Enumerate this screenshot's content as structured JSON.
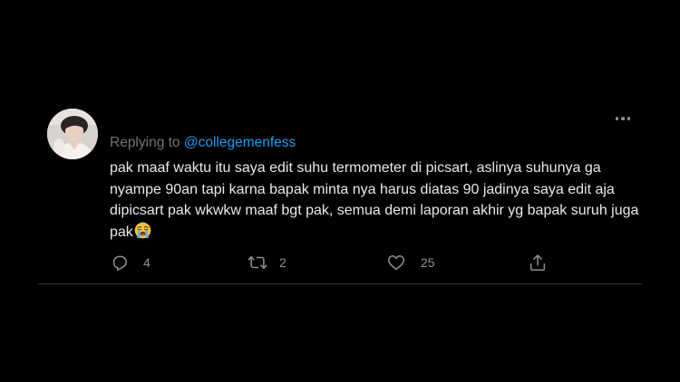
{
  "tweet": {
    "replying_prefix": "Replying to ",
    "replying_handle": "@collegemenfess",
    "body": "pak maaf waktu itu saya edit suhu termometer di picsart, aslinya suhunya ga nyampe 90an tapi karna bapak minta nya harus diatas 90 jadinya saya edit aja dipicsart pak wkwkw maaf bgt pak, semua demi laporan akhir yg bapak suruh juga pak",
    "emoji": "loudly-crying-face",
    "actions": {
      "reply_count": "4",
      "retweet_count": "2",
      "like_count": "25"
    }
  },
  "colors": {
    "background": "#000000",
    "text": "#e7e9ea",
    "muted": "#707479",
    "link": "#1d9bf0",
    "divider": "#2f3336"
  },
  "icons": {
    "more": "more-dots-icon",
    "reply": "reply-icon",
    "retweet": "retweet-icon",
    "like": "heart-icon",
    "share": "share-icon"
  }
}
